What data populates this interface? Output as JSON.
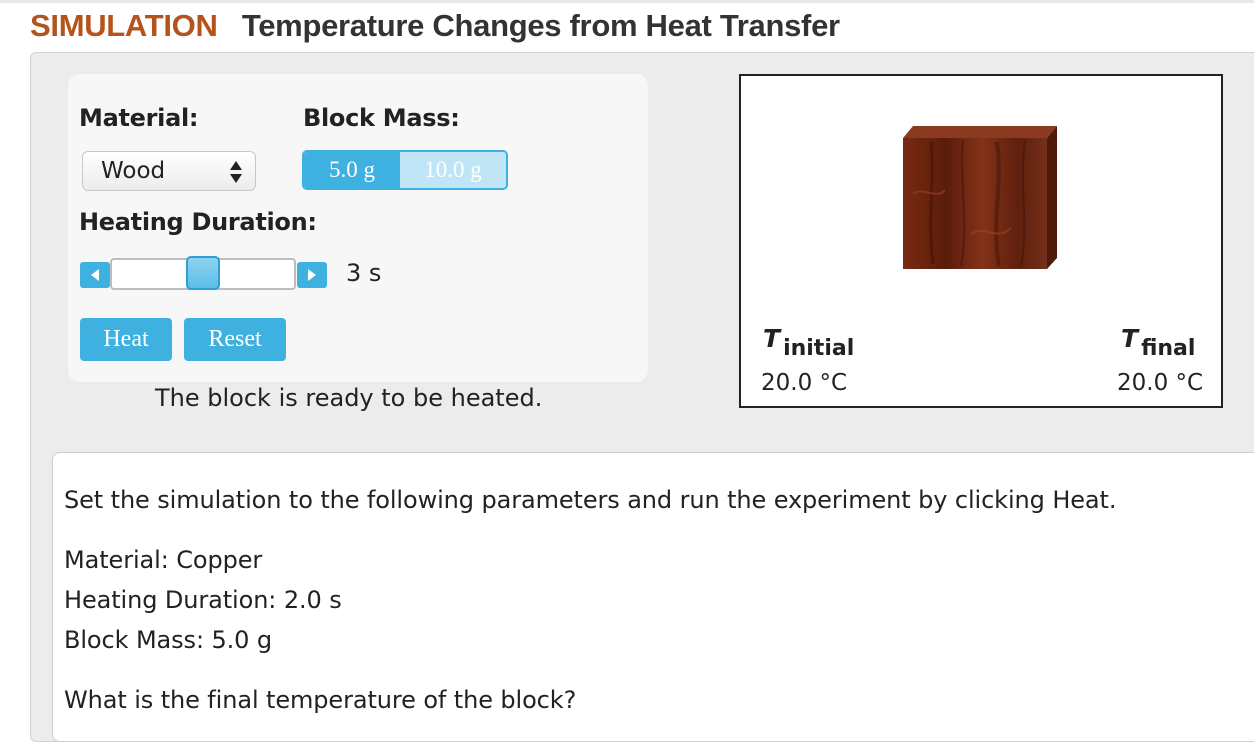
{
  "header": {
    "label": "SIMULATION",
    "title": "Temperature Changes from Heat Transfer"
  },
  "controls": {
    "material_label": "Material:",
    "material_value": "Wood",
    "mass_label": "Block Mass:",
    "mass_options": [
      "5.0 g",
      "10.0 g"
    ],
    "mass_selected": "5.0 g",
    "duration_label": "Heating Duration:",
    "duration_value": "3 s",
    "heat_button": "Heat",
    "reset_button": "Reset"
  },
  "status": "The block is ready to be heated.",
  "display": {
    "t_symbol": "T",
    "initial_label": "initial",
    "final_label": "final",
    "initial_value": "20.0 °C",
    "final_value": "20.0 °C"
  },
  "question": {
    "instruction": "Set the simulation to the following parameters and run the experiment by clicking Heat.",
    "param_material": "Material: Copper",
    "param_duration": "Heating Duration: 2.0 s",
    "param_mass": "Block Mass: 5.0 g",
    "prompt": "What is the final temperature of the block?"
  },
  "colors": {
    "brand": "#b4541c",
    "accent": "#3fb1e0",
    "wood": "#6a2612"
  },
  "icons": [
    "updown-arrows-icon",
    "left-arrow-icon",
    "right-arrow-icon",
    "wood-block-icon"
  ]
}
